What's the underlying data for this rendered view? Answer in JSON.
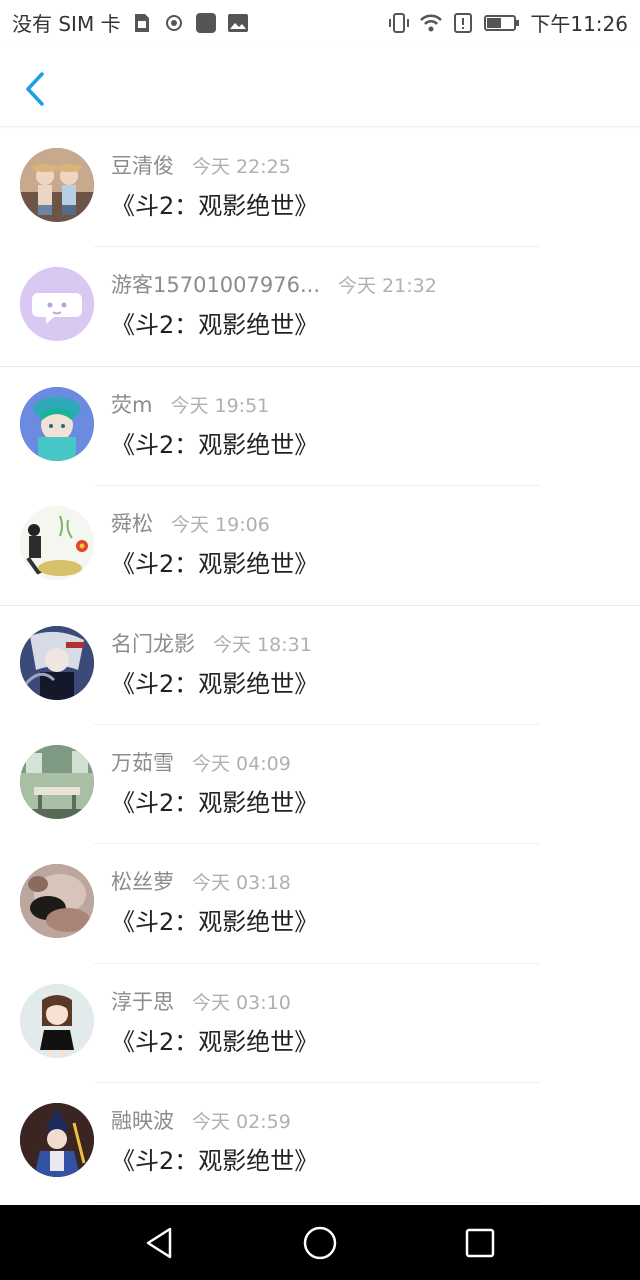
{
  "status_bar": {
    "carrier": "没有 SIM 卡",
    "time": "下午11:26",
    "icons": [
      "sim-icon",
      "hotspot-icon",
      "app-icon",
      "image-icon",
      "vibrate-icon",
      "wifi-icon",
      "alert-icon",
      "battery-icon"
    ]
  },
  "header": {
    "back_icon": "chevron-left-icon",
    "accent": "#1a9fe8"
  },
  "list": {
    "items": [
      {
        "name": "豆清俊",
        "time": "今天 22:25",
        "title": "《斗2：观影绝世》",
        "avatar": "avatar-photo-kids",
        "avatar_color": "#8a6a55"
      },
      {
        "name": "游客15701007976...",
        "time": "今天 21:32",
        "title": "《斗2：观影绝世》",
        "avatar": "avatar-default-chat",
        "avatar_color": "#d9c8f2"
      },
      {
        "name": "荧m",
        "time": "今天 19:51",
        "title": "《斗2：观影绝世》",
        "avatar": "avatar-anime-girl",
        "avatar_color": "#5b7bd6"
      },
      {
        "name": "舜松",
        "time": "今天 19:06",
        "title": "《斗2：观影绝世》",
        "avatar": "avatar-illustration",
        "avatar_color": "#e6efe1"
      },
      {
        "name": "名门龙影",
        "time": "今天 18:31",
        "title": "《斗2：观影绝世》",
        "avatar": "avatar-anime-dark",
        "avatar_color": "#2c3550"
      },
      {
        "name": "万茹雪",
        "time": "今天 04:09",
        "title": "《斗2：观影绝世》",
        "avatar": "avatar-photo-room",
        "avatar_color": "#6f8a73"
      },
      {
        "name": "松丝萝",
        "time": "今天 03:18",
        "title": "《斗2：观影绝世》",
        "avatar": "avatar-photo-blur",
        "avatar_color": "#9a7a6c"
      },
      {
        "name": "淳于思",
        "time": "今天 03:10",
        "title": "《斗2：观影绝世》",
        "avatar": "avatar-cartoon-girl",
        "avatar_color": "#dfe8ea"
      },
      {
        "name": "融映波",
        "time": "今天 02:59",
        "title": "《斗2：观影绝世》",
        "avatar": "avatar-anime-mage",
        "avatar_color": "#2b1d1d"
      }
    ]
  },
  "nav_bar": {
    "icons": [
      "back-triangle-icon",
      "home-circle-icon",
      "recents-square-icon"
    ]
  }
}
